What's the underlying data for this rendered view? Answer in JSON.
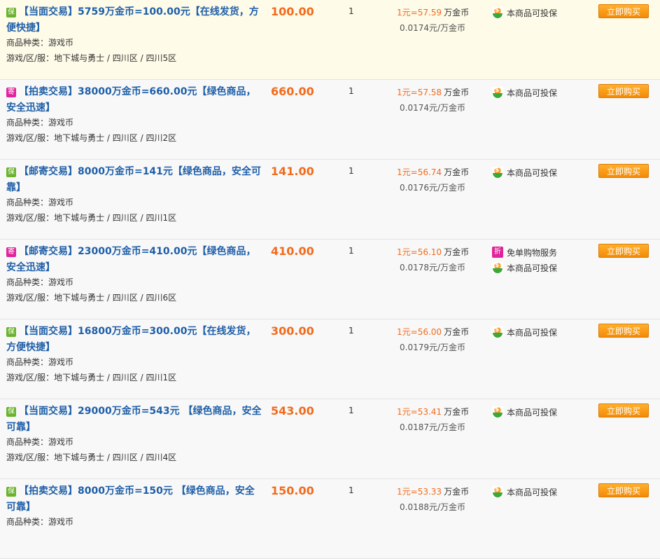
{
  "listings": [
    {
      "badge": "保",
      "badge_color": "#6bb32e",
      "highlight": true,
      "title": "【当面交易】5759万金币=100.00元【在线发货，方便快捷】",
      "price": "100.00",
      "qty": "1",
      "rate_prefix": "1元=",
      "rate_value": "57.59",
      "rate_unit": "万金币",
      "unit_price": "0.0174元/万金币",
      "services": [
        {
          "icon": "shield-icon",
          "label": "本商品可投保"
        }
      ],
      "category_label": "商品种类：",
      "category": "游戏币",
      "server_label": "游戏/区/服：",
      "server": "地下城与勇士 / 四川区 / 四川5区",
      "buy_label": "立即购买"
    },
    {
      "badge": "寄",
      "badge_color": "#e0249a",
      "highlight": false,
      "title": "【拍卖交易】38000万金币=660.00元【绿色商品，安全迅速】",
      "price": "660.00",
      "qty": "1",
      "rate_prefix": "1元=",
      "rate_value": "57.58",
      "rate_unit": "万金币",
      "unit_price": "0.0174元/万金币",
      "services": [
        {
          "icon": "shield-icon",
          "label": "本商品可投保"
        }
      ],
      "category_label": "商品种类：",
      "category": "游戏币",
      "server_label": "游戏/区/服：",
      "server": "地下城与勇士 / 四川区 / 四川2区",
      "buy_label": "立即购买"
    },
    {
      "badge": "保",
      "badge_color": "#6bb32e",
      "highlight": false,
      "title": "【邮寄交易】8000万金币=141元【绿色商品，安全可靠】",
      "price": "141.00",
      "qty": "1",
      "rate_prefix": "1元=",
      "rate_value": "56.74",
      "rate_unit": "万金币",
      "unit_price": "0.0176元/万金币",
      "services": [
        {
          "icon": "shield-icon",
          "label": "本商品可投保"
        }
      ],
      "category_label": "商品种类：",
      "category": "游戏币",
      "server_label": "游戏/区/服：",
      "server": "地下城与勇士 / 四川区 / 四川1区",
      "buy_label": "立即购买"
    },
    {
      "badge": "寄",
      "badge_color": "#e0249a",
      "highlight": false,
      "title": "【邮寄交易】23000万金币=410.00元【绿色商品，安全迅速】",
      "price": "410.00",
      "qty": "1",
      "rate_prefix": "1元=",
      "rate_value": "56.10",
      "rate_unit": "万金币",
      "unit_price": "0.0178元/万金币",
      "services": [
        {
          "icon": "discount-icon",
          "label": "免单购物服务",
          "glyph": "折"
        },
        {
          "icon": "shield-icon",
          "label": "本商品可投保"
        }
      ],
      "category_label": "商品种类：",
      "category": "游戏币",
      "server_label": "游戏/区/服：",
      "server": "地下城与勇士 / 四川区 / 四川6区",
      "buy_label": "立即购买"
    },
    {
      "badge": "保",
      "badge_color": "#6bb32e",
      "highlight": false,
      "title": "【当面交易】16800万金币=300.00元【在线发货，方便快捷】",
      "price": "300.00",
      "qty": "1",
      "rate_prefix": "1元=",
      "rate_value": "56.00",
      "rate_unit": "万金币",
      "unit_price": "0.0179元/万金币",
      "services": [
        {
          "icon": "shield-icon",
          "label": "本商品可投保"
        }
      ],
      "category_label": "商品种类：",
      "category": "游戏币",
      "server_label": "游戏/区/服：",
      "server": "地下城与勇士 / 四川区 / 四川1区",
      "buy_label": "立即购买"
    },
    {
      "badge": "保",
      "badge_color": "#6bb32e",
      "highlight": false,
      "title": "【当面交易】29000万金币=543元 【绿色商品，安全可靠】",
      "price": "543.00",
      "qty": "1",
      "rate_prefix": "1元=",
      "rate_value": "53.41",
      "rate_unit": "万金币",
      "unit_price": "0.0187元/万金币",
      "services": [
        {
          "icon": "shield-icon",
          "label": "本商品可投保"
        }
      ],
      "category_label": "商品种类：",
      "category": "游戏币",
      "server_label": "游戏/区/服：",
      "server": "地下城与勇士 / 四川区 / 四川4区",
      "buy_label": "立即购买"
    },
    {
      "badge": "保",
      "badge_color": "#6bb32e",
      "highlight": false,
      "title": "【拍卖交易】8000万金币=150元 【绿色商品，安全可靠】",
      "price": "150.00",
      "qty": "1",
      "rate_prefix": "1元=",
      "rate_value": "53.33",
      "rate_unit": "万金币",
      "unit_price": "0.0188元/万金币",
      "services": [
        {
          "icon": "shield-icon",
          "label": "本商品可投保"
        }
      ],
      "category_label": "商品种类：",
      "category": "游戏币",
      "server_label": "",
      "server": "",
      "buy_label": "立即购买"
    }
  ]
}
